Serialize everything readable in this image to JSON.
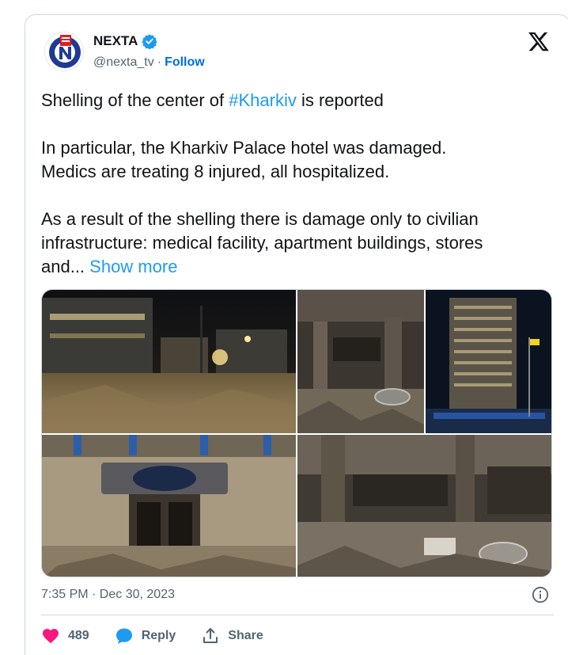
{
  "account": {
    "display_name": "NEXTA",
    "handle": "@nexta_tv",
    "separator": "·",
    "follow_label": "Follow"
  },
  "tweet": {
    "line1_before": "Shelling of the center of ",
    "hashtag": "#Kharkiv",
    "line1_after": " is reported",
    "para2_line1": "In particular, the Kharkiv Palace hotel was damaged.",
    "para2_line2": "Medics are treating 8 injured, all hospitalized.",
    "para3_line1": "As a result of the shelling there is damage only to civilian",
    "para3_line2": "infrastructure: medical facility, apartment buildings, stores",
    "para3_line3": "and... ",
    "show_more": "Show more"
  },
  "meta": {
    "timestamp": "7:35 PM · Dec 30, 2023"
  },
  "actions": {
    "likes_count": "489",
    "reply_label": "Reply",
    "share_label": "Share"
  },
  "colors": {
    "link": "#1d9bf0",
    "follow": "#006fd6",
    "like": "#f91880",
    "reply": "#1d9bf0",
    "verified": "#1d9bf0",
    "muted": "#536471"
  },
  "icons": [
    "verified-badge-icon",
    "x-logo-icon",
    "info-icon",
    "heart-icon",
    "reply-bubble-icon",
    "share-icon"
  ]
}
